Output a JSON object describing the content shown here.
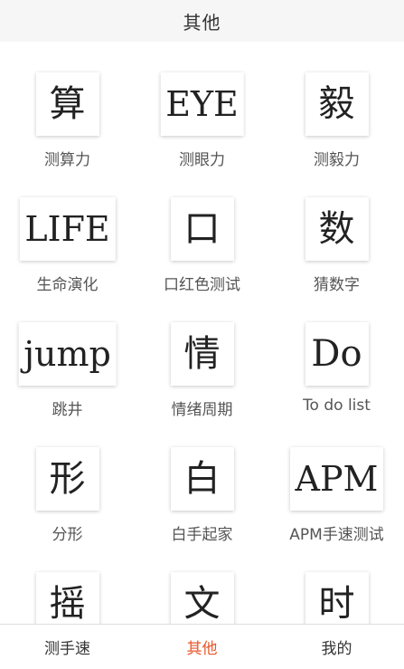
{
  "header": {
    "title": "其他"
  },
  "grid": {
    "items": [
      {
        "glyph": "算",
        "label": "测算力",
        "wide": false
      },
      {
        "glyph": "EYE",
        "label": "测眼力",
        "wide": true
      },
      {
        "glyph": "毅",
        "label": "测毅力",
        "wide": false
      },
      {
        "glyph": "LIFE",
        "label": "生命演化",
        "wide": true
      },
      {
        "glyph": "口",
        "label": "口红色测试",
        "wide": false
      },
      {
        "glyph": "数",
        "label": "猜数字",
        "wide": false
      },
      {
        "glyph": "jump",
        "label": "跳井",
        "wide": true
      },
      {
        "glyph": "情",
        "label": "情绪周期",
        "wide": false
      },
      {
        "glyph": "Do",
        "label": "To do list",
        "wide": false
      },
      {
        "glyph": "形",
        "label": "分形",
        "wide": false
      },
      {
        "glyph": "白",
        "label": "白手起家",
        "wide": false
      },
      {
        "glyph": "APM",
        "label": "APM手速测试",
        "wide": true
      },
      {
        "glyph": "摇",
        "label": "",
        "wide": false
      },
      {
        "glyph": "文",
        "label": "",
        "wide": false
      },
      {
        "glyph": "时",
        "label": "",
        "wide": false
      }
    ]
  },
  "tabs": [
    {
      "label": "测手速",
      "active": false
    },
    {
      "label": "其他",
      "active": true
    },
    {
      "label": "我的",
      "active": false
    }
  ],
  "colors": {
    "accent": "#e8572a",
    "header_bg": "#f6f6f6"
  }
}
